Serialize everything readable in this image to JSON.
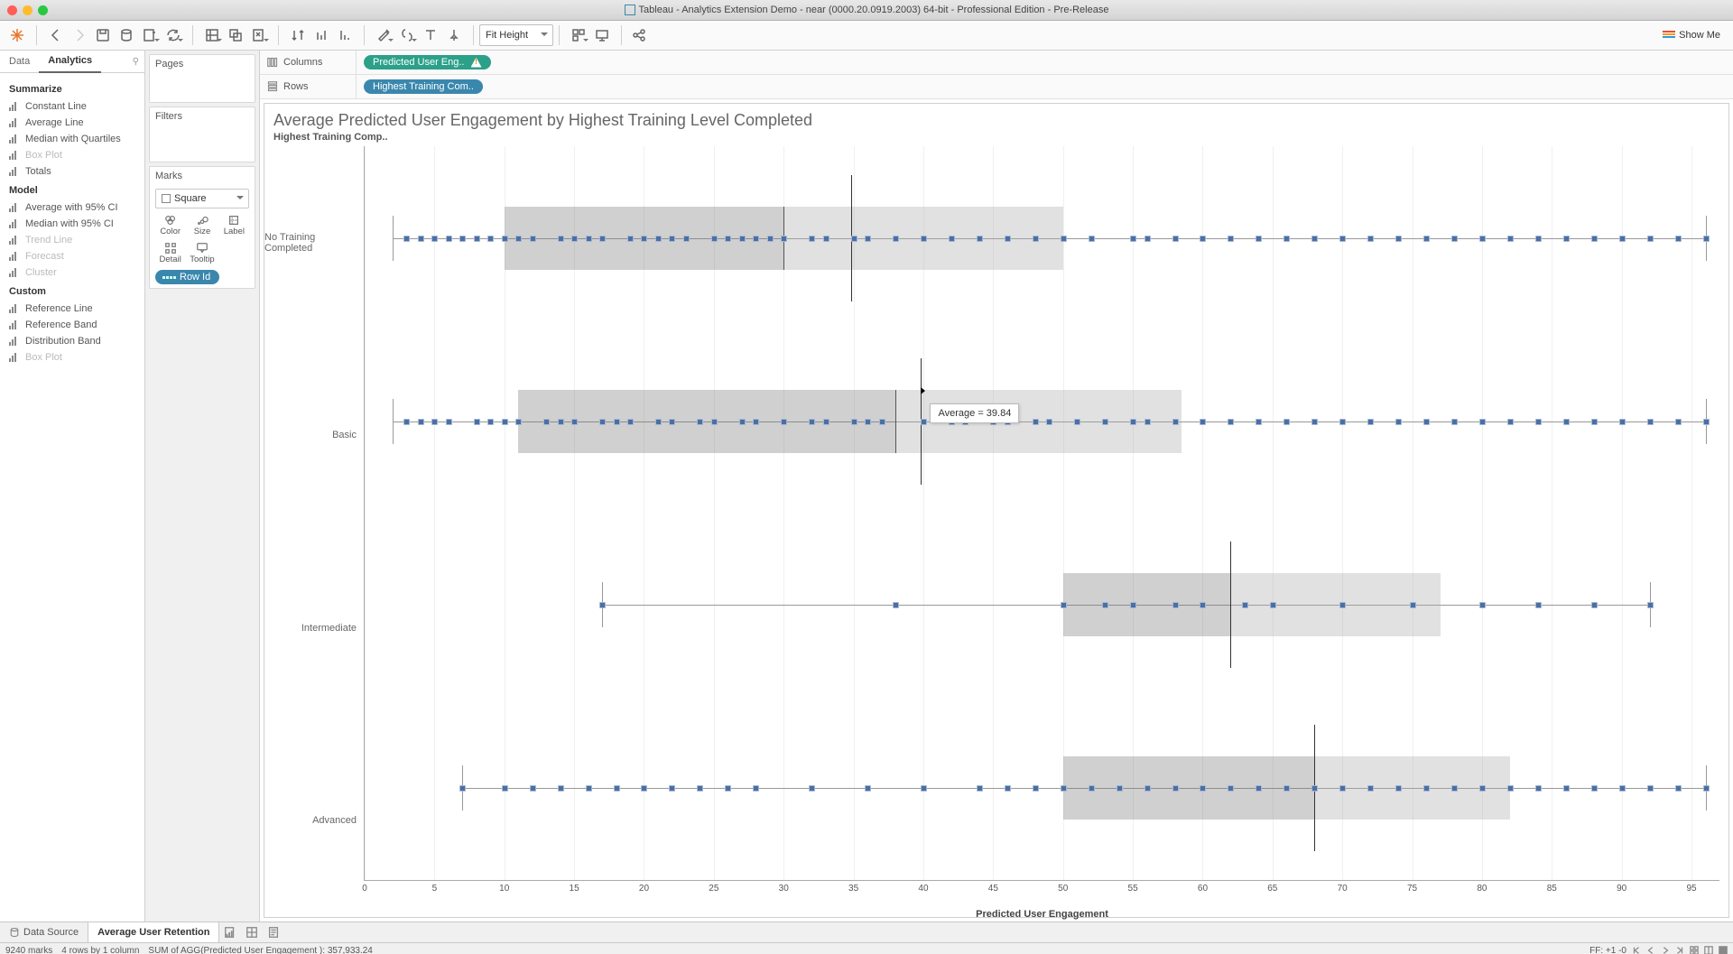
{
  "window_title": "Tableau - Analytics Extension Demo - near (0000.20.0919.2003) 64-bit - Professional Edition - Pre-Release",
  "toolbar": {
    "fit_mode": "Fit Height",
    "show_me": "Show Me"
  },
  "left_tabs": {
    "data": "Data",
    "analytics": "Analytics"
  },
  "analytics": {
    "summarize_head": "Summarize",
    "summarize": [
      {
        "label": "Constant Line",
        "disabled": false
      },
      {
        "label": "Average Line",
        "disabled": false
      },
      {
        "label": "Median with Quartiles",
        "disabled": false
      },
      {
        "label": "Box Plot",
        "disabled": true
      },
      {
        "label": "Totals",
        "disabled": false
      }
    ],
    "model_head": "Model",
    "model": [
      {
        "label": "Average with 95% CI",
        "disabled": false
      },
      {
        "label": "Median with 95% CI",
        "disabled": false
      },
      {
        "label": "Trend Line",
        "disabled": true
      },
      {
        "label": "Forecast",
        "disabled": true
      },
      {
        "label": "Cluster",
        "disabled": true
      }
    ],
    "custom_head": "Custom",
    "custom": [
      {
        "label": "Reference Line",
        "disabled": false
      },
      {
        "label": "Reference Band",
        "disabled": false
      },
      {
        "label": "Distribution Band",
        "disabled": false
      },
      {
        "label": "Box Plot",
        "disabled": true
      }
    ]
  },
  "cards": {
    "pages": "Pages",
    "filters": "Filters",
    "marks": "Marks",
    "mark_type": "Square",
    "grid": {
      "color": "Color",
      "size": "Size",
      "label": "Label",
      "detail": "Detail",
      "tooltip": "Tooltip"
    },
    "row_pill": "Row Id"
  },
  "shelves": {
    "columns": "Columns",
    "rows": "Rows",
    "col_pill": "Predicted User Eng..",
    "row_pill": "Highest Training Com.."
  },
  "viz": {
    "title": "Average Predicted User Engagement by Highest Training Level Completed",
    "subtitle": "Highest Training Comp..",
    "xlabel": "Predicted User Engagement",
    "tooltip": "Average = 39.84"
  },
  "bottom": {
    "data_source": "Data Source",
    "sheet_tab": "Average User Retention"
  },
  "status": {
    "marks": "9240 marks",
    "shape": "4 rows by 1 column",
    "sum": "SUM of AGG(Predicted User Engagement ): 357,933.24",
    "ff": "FF: +1 -0"
  },
  "chart_data": {
    "type": "boxplot_with_points",
    "xlabel": "Predicted User Engagement",
    "xlim": [
      0,
      97
    ],
    "ticks": [
      0,
      5,
      10,
      15,
      20,
      25,
      30,
      35,
      40,
      45,
      50,
      55,
      60,
      65,
      70,
      75,
      80,
      85,
      90,
      95
    ],
    "categories": [
      "No Training Completed",
      "Basic",
      "Intermediate",
      "Advanced"
    ],
    "boxes": [
      {
        "whisker_lo": 2,
        "q1": 10,
        "median": 30,
        "q3": 50,
        "whisker_hi": 96,
        "avg": 34.8
      },
      {
        "whisker_lo": 2,
        "q1": 11,
        "median": 38,
        "q3": 58.5,
        "whisker_hi": 96,
        "avg": 39.84
      },
      {
        "whisker_lo": 17,
        "q1": 50,
        "median": 62,
        "q3": 77,
        "whisker_hi": 92,
        "avg": 62
      },
      {
        "whisker_lo": 7,
        "q1": 50,
        "median": 68,
        "q3": 82,
        "whisker_hi": 96,
        "avg": 68
      }
    ],
    "points": [
      [
        3,
        4,
        5,
        6,
        7,
        8,
        9,
        10,
        11,
        12,
        14,
        15,
        16,
        17,
        19,
        20,
        21,
        22,
        23,
        25,
        26,
        27,
        28,
        29,
        30,
        32,
        33,
        35,
        36,
        38,
        40,
        42,
        44,
        46,
        48,
        50,
        52,
        55,
        56,
        58,
        60,
        62,
        64,
        66,
        68,
        70,
        72,
        74,
        76,
        78,
        80,
        82,
        84,
        86,
        88,
        90,
        92,
        94,
        96
      ],
      [
        3,
        4,
        5,
        6,
        8,
        9,
        10,
        11,
        13,
        14,
        15,
        17,
        18,
        19,
        21,
        22,
        24,
        25,
        27,
        28,
        30,
        32,
        33,
        35,
        36,
        37,
        40,
        42,
        43,
        45,
        46,
        48,
        49,
        51,
        53,
        55,
        56,
        58,
        60,
        62,
        64,
        66,
        68,
        70,
        72,
        74,
        76,
        78,
        80,
        82,
        84,
        86,
        88,
        90,
        92,
        94,
        96
      ],
      [
        17,
        38,
        50,
        53,
        55,
        58,
        60,
        63,
        65,
        70,
        75,
        80,
        84,
        88,
        92
      ],
      [
        7,
        10,
        12,
        14,
        16,
        18,
        20,
        22,
        24,
        26,
        28,
        32,
        36,
        40,
        44,
        46,
        48,
        50,
        52,
        54,
        56,
        58,
        60,
        62,
        64,
        66,
        68,
        70,
        72,
        74,
        76,
        78,
        80,
        82,
        84,
        86,
        88,
        90,
        92,
        94,
        96
      ]
    ],
    "tooltip_target": {
      "row": 1,
      "value": 39.84
    }
  }
}
